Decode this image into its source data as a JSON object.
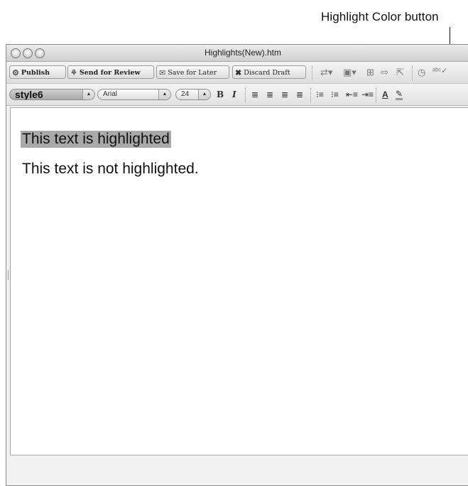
{
  "callout": {
    "label": "Highlight Color button"
  },
  "window": {
    "title": "Highlights(New).htm"
  },
  "toolbar": {
    "publish": "Publish",
    "send_review": "Send for Review",
    "save_later": "Save for Later",
    "discard": "Discard Draft"
  },
  "format": {
    "style_value": "style6",
    "font_value": "Arial",
    "size_value": "24",
    "bold": "B",
    "italic": "I"
  },
  "content": {
    "highlighted": "This text is highlighted",
    "plain": "This text is not highlighted."
  },
  "colors": {
    "highlight": "#a9a9a9"
  }
}
